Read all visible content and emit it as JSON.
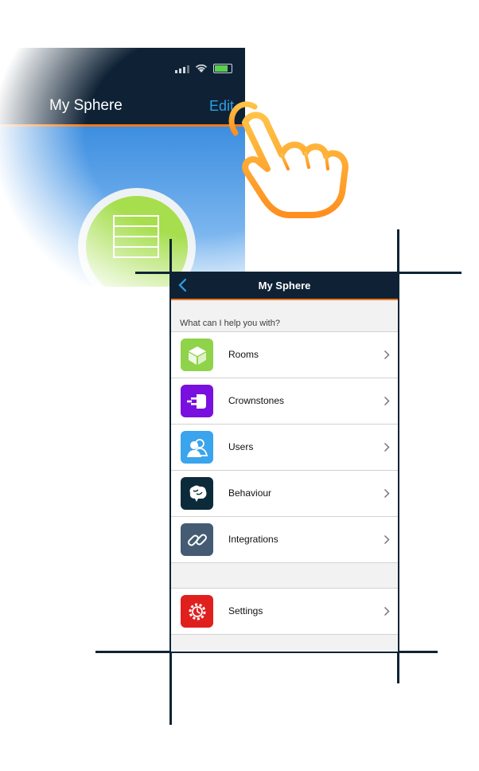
{
  "background_screen": {
    "title": "My Sphere",
    "edit_label": "Edit"
  },
  "nav": {
    "title": "My Sphere",
    "back_icon": "chevron-left-icon"
  },
  "section_header": "What can I help you with?",
  "menu_items": [
    {
      "label": "Rooms",
      "icon": "cube-icon",
      "color": "#8fd34a"
    },
    {
      "label": "Crownstones",
      "icon": "plug-icon",
      "color": "#7a10e0"
    },
    {
      "label": "Users",
      "icon": "users-icon",
      "color": "#3aa4ec"
    },
    {
      "label": "Behaviour",
      "icon": "brain-icon",
      "color": "#0c2b3a"
    },
    {
      "label": "Integrations",
      "icon": "link-icon",
      "color": "#445b73"
    }
  ],
  "settings_item": {
    "label": "Settings",
    "icon": "gear-icon",
    "color": "#e0201e"
  },
  "colors": {
    "header": "#0f2235",
    "accent": "#f07a1c",
    "link": "#2ba1e8"
  }
}
